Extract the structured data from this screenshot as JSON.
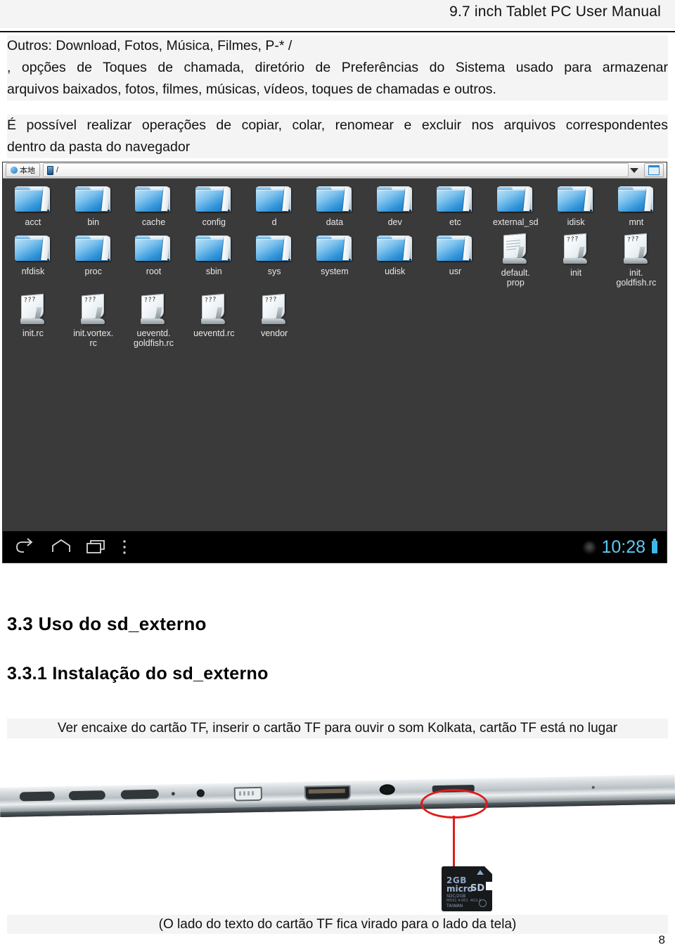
{
  "header": {
    "title": "9.7 inch Tablet PC User Manual"
  },
  "paragraphs": {
    "p1_line1": "Outros: Download, Fotos, Música, Filmes, P-* /",
    "p1_line2": ", opções de Toques de chamada, diretório de Preferências do Sistema usado para armazenar",
    "p1_line3": "arquivos baixados, fotos, filmes, músicas, vídeos, toques de chamadas e outros.",
    "p2_line1": "É possível realizar operações de copiar, colar, renomear e excluir nos arquivos correspondentes",
    "p2_line2": "dentro da pasta do navegador"
  },
  "file_manager": {
    "toolbar": {
      "local_button": "本地",
      "path": "/",
      "globe_icon": "globe-icon",
      "device_icon": "device-icon",
      "dropdown_icon": "chevron-down-icon",
      "window_icon": "window-icon"
    },
    "rows": [
      [
        {
          "name": "acct",
          "type": "folder"
        },
        {
          "name": "bin",
          "type": "folder"
        },
        {
          "name": "cache",
          "type": "folder"
        },
        {
          "name": "config",
          "type": "folder"
        },
        {
          "name": "d",
          "type": "folder"
        },
        {
          "name": "data",
          "type": "folder"
        },
        {
          "name": "dev",
          "type": "folder"
        },
        {
          "name": "etc",
          "type": "folder"
        },
        {
          "name": "external_sd",
          "type": "folder"
        },
        {
          "name": "idisk",
          "type": "folder"
        },
        {
          "name": "mnt",
          "type": "folder"
        }
      ],
      [
        {
          "name": "nfdisk",
          "type": "folder"
        },
        {
          "name": "proc",
          "type": "folder"
        },
        {
          "name": "root",
          "type": "folder"
        },
        {
          "name": "sbin",
          "type": "folder"
        },
        {
          "name": "sys",
          "type": "folder"
        },
        {
          "name": "system",
          "type": "folder"
        },
        {
          "name": "udisk",
          "type": "folder"
        },
        {
          "name": "usr",
          "type": "folder"
        },
        {
          "name": "default.\nprop",
          "type": "document"
        },
        {
          "name": "init",
          "type": "file"
        },
        {
          "name": "init.\ngoldfish.rc",
          "type": "file"
        }
      ],
      [
        {
          "name": "init.rc",
          "type": "file"
        },
        {
          "name": "init.vortex.\nrc",
          "type": "file"
        },
        {
          "name": "ueventd.\ngoldfish.rc",
          "type": "file"
        },
        {
          "name": "ueventd.rc",
          "type": "file"
        },
        {
          "name": "vendor",
          "type": "file"
        }
      ]
    ],
    "navbar": {
      "back_icon": "back-arrow-icon",
      "home_icon": "home-icon",
      "recents_icon": "recent-apps-icon",
      "menu_icon": "overflow-menu-icon",
      "status_icon": "notification-dot-icon",
      "clock": "10:28",
      "battery_icon": "battery-icon"
    }
  },
  "sections": {
    "h2_1": "3.3 Uso do sd_externo",
    "h2_2": "3.3.1 Instalação do sd_externo",
    "caption": "Ver encaixe do cartão TF, inserir o cartão TF para ouvir o som Kolkata, cartão TF está no lugar"
  },
  "photo": {
    "annotation_icon": "red-ellipse-callout",
    "sd_card": {
      "capacity": "2GB",
      "brand": "micro",
      "logo": "SD",
      "line1": "SDC/2GB",
      "line2": "MD31 4-001 .4G3,2",
      "line3": "TAIWAN"
    }
  },
  "footer": {
    "note": "(O lado do texto do cartão TF fica virado para o lado da tela)",
    "page_number": "8"
  },
  "colors": {
    "accent_red": "#e01b1b",
    "clock_blue": "#5ec8f2",
    "folder_blue": "#2f93d9",
    "screen_bg": "#3a3a3a"
  }
}
